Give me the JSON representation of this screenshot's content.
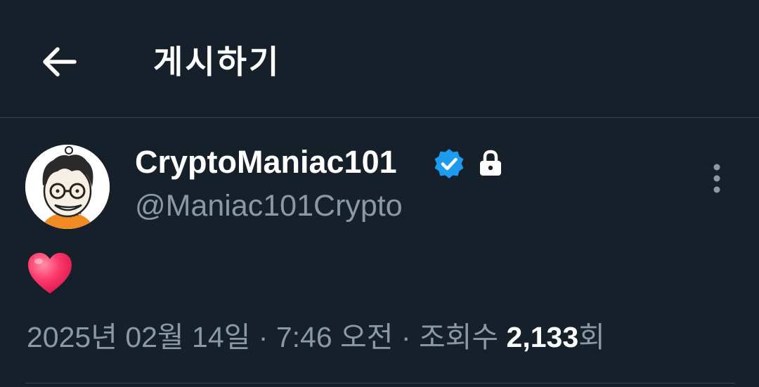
{
  "header": {
    "title": "게시하기",
    "back_icon": "arrow-left-icon"
  },
  "author": {
    "display_name": "CryptoManiac101",
    "handle": "@Maniac101Crypto",
    "verified_icon": "verified-badge-icon",
    "protected_icon": "lock-icon",
    "verified_color": "#1d9bf0"
  },
  "post": {
    "content_emoji": "heart-emoji"
  },
  "meta": {
    "date": "2025년 02월 14일",
    "separator": "·",
    "time": "7:46 오전",
    "views_label": "조회수",
    "views_count": "2,133",
    "views_suffix": "회"
  },
  "colors": {
    "background": "#15202b",
    "secondary_text": "#8b98a5",
    "divider": "#38444d"
  }
}
